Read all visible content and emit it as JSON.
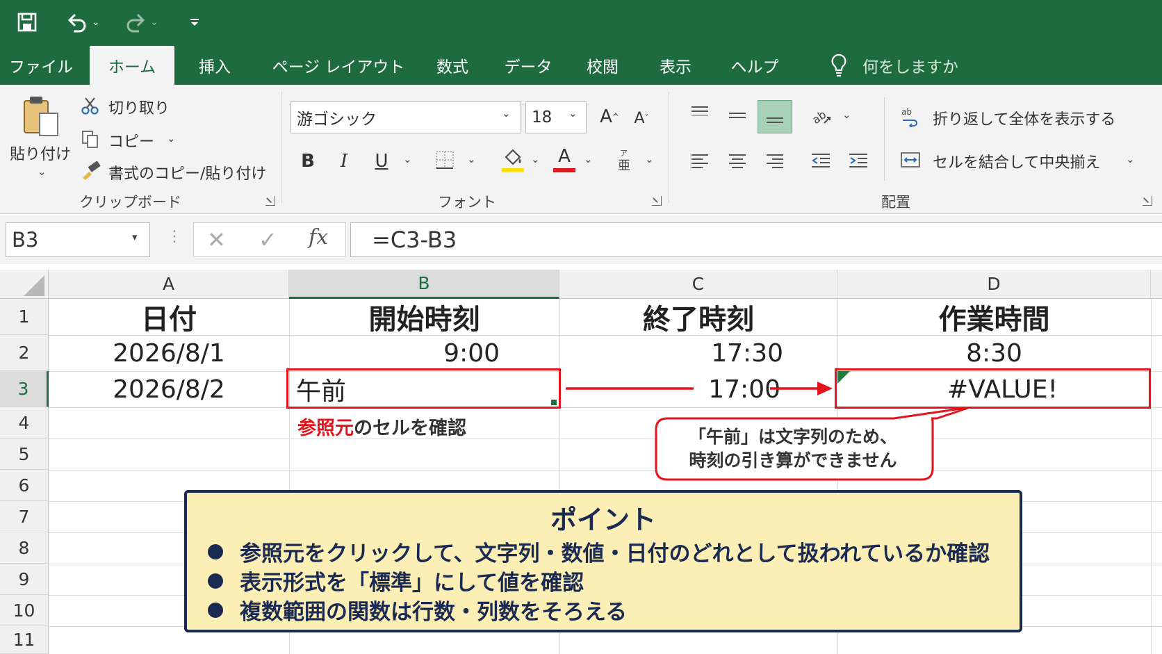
{
  "ribbon_tabs": [
    "ファイル",
    "ホーム",
    "挿入",
    "ページ レイアウト",
    "数式",
    "データ",
    "校閲",
    "表示",
    "ヘルプ"
  ],
  "tell_me": "何をしますか",
  "clipboard": {
    "paste": "貼り付け",
    "cut": "切り取り",
    "copy": "コピー",
    "format_painter": "書式のコピー/貼り付け",
    "group": "クリップボード"
  },
  "font": {
    "name": "游ゴシック",
    "size": "18",
    "bold": "B",
    "italic": "I",
    "underline": "U",
    "grow": "A",
    "shrink": "A",
    "group": "フォント",
    "underline_color": "#ffe100",
    "font_color": "#e3141c"
  },
  "alignment": {
    "wrap": "折り返して全体を表示する",
    "merge": "セルを結合して中央揃え",
    "group": "配置"
  },
  "formula_bar": {
    "name_box": "B3",
    "fx": "fx",
    "formula": "=C3-B3"
  },
  "columns": [
    "A",
    "B",
    "C",
    "D"
  ],
  "rows": [
    "1",
    "2",
    "3",
    "4",
    "5",
    "6",
    "7",
    "8",
    "9",
    "10",
    "11"
  ],
  "cells": {
    "A1": "日付",
    "B1": "開始時刻",
    "C1": "終了時刻",
    "D1": "作業時間",
    "A2": "2026/8/1",
    "B2": "9:00",
    "C2": "17:30",
    "D2": "8:30",
    "A3": "2026/8/2",
    "B3": "午前",
    "C3": "17:00",
    "D3": "#VALUE!"
  },
  "annotation": {
    "ref_red": "参照元",
    "ref_rest": "のセルを確認",
    "bubble_line1": "「午前」は文字列のため、",
    "bubble_line2": "時刻の引き算ができません"
  },
  "point": {
    "title": "ポイント",
    "items": [
      "参照元をクリックして、文字列・数値・日付のどれとして扱われているか確認",
      "表示形式を「標準」にして値を確認",
      "複数範囲の関数は行数・列数をそろえる"
    ]
  },
  "colors": {
    "excel_green": "#1e6b40",
    "annotation_red": "#e3141c",
    "point_bg": "#fbefb5",
    "point_navy": "#1b2a52"
  }
}
